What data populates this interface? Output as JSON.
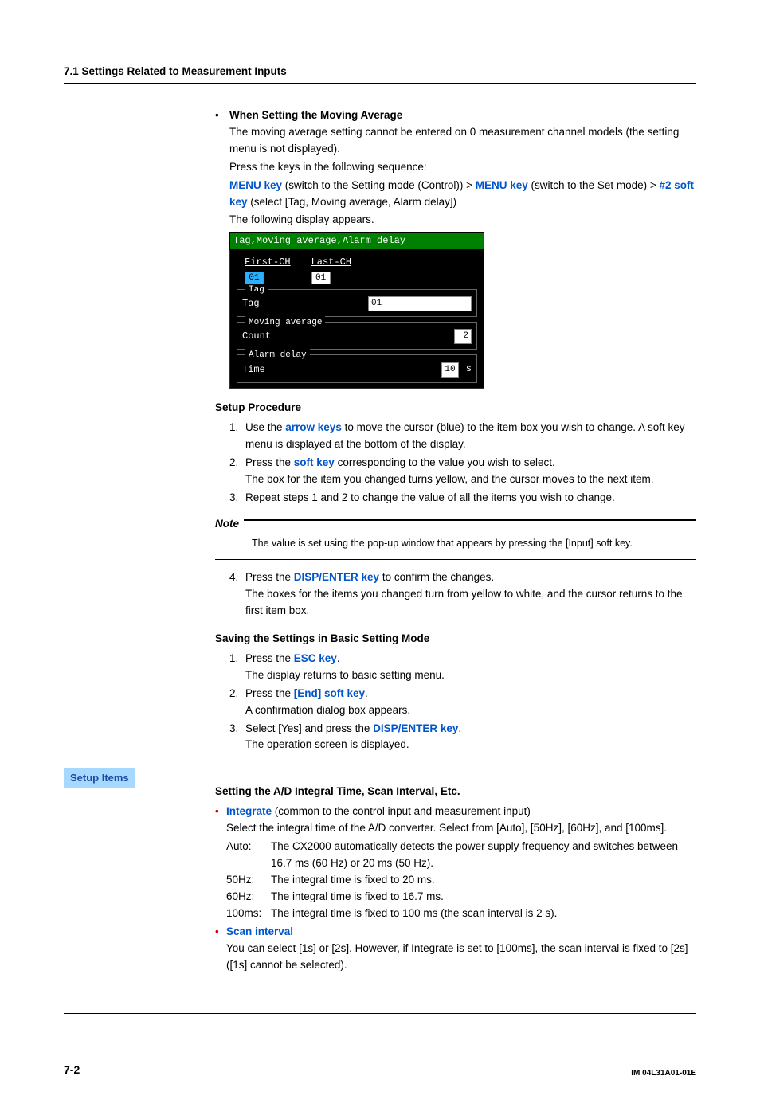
{
  "header": {
    "section": "7.1  Settings Related to Measurement Inputs"
  },
  "moving_avg": {
    "bullet": "•",
    "title": "When Setting the Moving Average",
    "p1": "The moving average setting cannot be entered on 0 measurement channel models (the setting menu is not displayed).",
    "p2": "Press the keys in the following sequence:",
    "seq_menu1": "MENU key",
    "seq_menu1_after": " (switch to the Setting mode (Control)) > ",
    "seq_menu2": "MENU key",
    "seq_menu2_after": " (switch to the Set mode) > ",
    "seq_soft": "#2 soft key",
    "seq_soft_after": " (select [Tag, Moving average, Alarm delay])",
    "p3": "The following display appears."
  },
  "screen": {
    "title": "Tag,Moving average,Alarm delay",
    "first_ch_label": "First-CH",
    "first_ch_val": "01",
    "last_ch_label": "Last-CH",
    "last_ch_val": "01",
    "tag_group": "Tag",
    "tag_label": "Tag",
    "tag_val": "01",
    "mavg_group": "Moving average",
    "mavg_label": "Count",
    "mavg_val": "2",
    "alarm_group": "Alarm delay",
    "alarm_label": "Time",
    "alarm_val": "10",
    "alarm_unit": "s"
  },
  "setup_proc": {
    "heading": "Setup Procedure",
    "s1_pre": "Use the ",
    "s1_kw": "arrow keys",
    "s1_post": " to move the cursor (blue) to the item box you wish to change. A soft key menu is displayed at the bottom of the display.",
    "s2_pre": "Press the ",
    "s2_kw": "soft key",
    "s2_post": " corresponding to the value you wish to select.",
    "s2_extra": "The box for the item you changed turns yellow, and the cursor moves to the next item.",
    "s3": "Repeat steps 1 and 2 to change the value of all the items you wish to change."
  },
  "note": {
    "label": "Note",
    "text": "The value is set using the pop-up window that appears by pressing the [Input] soft key."
  },
  "step4": {
    "pre": "Press the ",
    "kw": "DISP/ENTER key",
    "post": " to confirm the changes.",
    "extra": "The boxes for the items you changed turn from yellow to white, and the cursor returns to the first item box."
  },
  "saving": {
    "heading": "Saving the Settings in Basic Setting Mode",
    "s1_pre": "Press the ",
    "s1_kw": "ESC key",
    "s1_post": ".",
    "s1_extra": "The display returns to basic setting menu.",
    "s2_pre": "Press the ",
    "s2_kw": "[End] soft key",
    "s2_post": ".",
    "s2_extra": "A confirmation dialog box appears.",
    "s3_pre": "Select [Yes] and press the ",
    "s3_kw": "DISP/ENTER key",
    "s3_post": ".",
    "s3_extra": "The operation screen is displayed."
  },
  "setup_items_label": "Setup Items",
  "ad": {
    "heading": "Setting the A/D Integral Time, Scan Interval, Etc.",
    "integrate_kw": "Integrate",
    "integrate_rest": " (common to the control input and measurement input)",
    "integrate_desc": "Select the integral time of the A/D converter.  Select from [Auto], [50Hz], [60Hz], and [100ms].",
    "auto_term": "Auto:",
    "auto_def": "The CX2000 automatically detects the power supply frequency and switches between 16.7 ms (60 Hz) or 20 ms (50 Hz).",
    "f50_term": "50Hz:",
    "f50_def": "The integral time is fixed to 20 ms.",
    "f60_term": "60Hz:",
    "f60_def": "The integral time is fixed to 16.7 ms.",
    "f100_term": "100ms:",
    "f100_def": "The integral time is fixed to 100 ms (the scan interval is 2 s).",
    "scan_kw": "Scan interval",
    "scan_desc": "You can select [1s] or [2s].  However, if Integrate is set to [100ms], the scan interval is fixed to [2s] ([1s] cannot be selected)."
  },
  "footer": {
    "page": "7-2",
    "doc": "IM 04L31A01-01E"
  }
}
